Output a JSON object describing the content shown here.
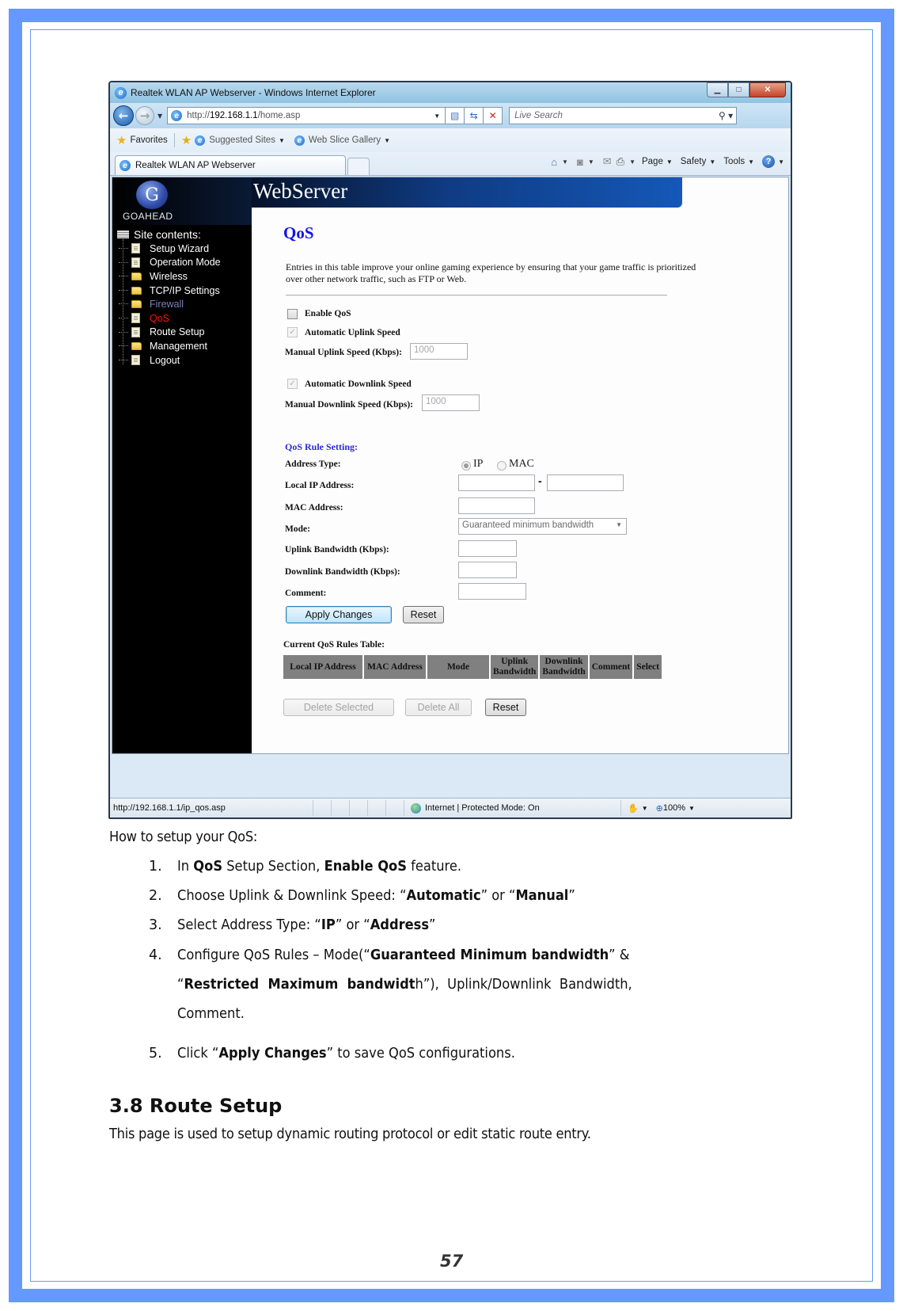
{
  "browser": {
    "window_title": "Realtek WLAN AP Webserver - Windows Internet Explorer",
    "address_prefix": "http://",
    "address_host": "192.168.1.1",
    "address_path": "/home.asp",
    "search_placeholder": "Live Search",
    "favorites_label": "Favorites",
    "fav_items": [
      "Suggested Sites",
      "Web Slice Gallery"
    ],
    "tab_title": "Realtek WLAN AP Webserver",
    "commands": [
      "Page",
      "Safety",
      "Tools"
    ],
    "status_url": "http://192.168.1.1/ip_qos.asp",
    "status_zone": "Internet | Protected Mode: On",
    "zoom_level": "100%"
  },
  "site": {
    "logo_text": "GOAHEAD",
    "banner_title": "WebServer",
    "tree_header": "Site contents:",
    "tree_items": [
      {
        "label": "Setup Wizard",
        "type": "doc",
        "state": "normal"
      },
      {
        "label": "Operation Mode",
        "type": "doc",
        "state": "normal"
      },
      {
        "label": "Wireless",
        "type": "folder",
        "state": "normal"
      },
      {
        "label": "TCP/IP Settings",
        "type": "folder",
        "state": "normal"
      },
      {
        "label": "Firewall",
        "type": "folder",
        "state": "dim"
      },
      {
        "label": "QoS",
        "type": "doc",
        "state": "active"
      },
      {
        "label": "Route Setup",
        "type": "doc",
        "state": "normal"
      },
      {
        "label": "Management",
        "type": "folder",
        "state": "normal"
      },
      {
        "label": "Logout",
        "type": "doc",
        "state": "normal"
      }
    ]
  },
  "qos": {
    "title": "QoS",
    "intro": "Entries in this table improve your online gaming experience by ensuring that your game traffic is prioritized over other network traffic, such as FTP or Web.",
    "enable_qos_label": "Enable QoS",
    "enable_qos_checked": false,
    "auto_uplink_label": "Automatic Uplink Speed",
    "auto_uplink_checked": true,
    "manual_uplink_label": "Manual Uplink Speed (Kbps):",
    "manual_uplink_value": "1000",
    "auto_downlink_label": "Automatic Downlink Speed",
    "auto_downlink_checked": true,
    "manual_downlink_label": "Manual Downlink Speed (Kbps):",
    "manual_downlink_value": "1000",
    "rule_heading": "QoS Rule Setting:",
    "address_type_label": "Address Type:",
    "address_type_options": [
      "IP",
      "MAC"
    ],
    "address_type_selected": "IP",
    "local_ip_label": "Local IP Address:",
    "local_ip_separator": "-",
    "mac_label": "MAC Address:",
    "mode_label": "Mode:",
    "mode_value": "Guaranteed minimum bandwidth",
    "uplink_bw_label": "Uplink Bandwidth (Kbps):",
    "downlink_bw_label": "Downlink Bandwidth (Kbps):",
    "comment_label": "Comment:",
    "apply_button": "Apply Changes",
    "reset_button": "Reset",
    "table_title": "Current QoS Rules Table:",
    "table_headers": [
      [
        "Local IP Address"
      ],
      [
        "MAC Address"
      ],
      [
        "Mode"
      ],
      [
        "Uplink",
        "Bandwidth"
      ],
      [
        "Downlink",
        "Bandwidth"
      ],
      [
        "Comment"
      ],
      [
        "Select"
      ]
    ],
    "delete_selected_button": "Delete Selected",
    "delete_all_button": "Delete All",
    "table_reset_button": "Reset"
  },
  "doc": {
    "how_to": "How to setup your QoS:",
    "steps": [
      [
        {
          "t": "In "
        },
        {
          "t": "QoS",
          "b": true
        },
        {
          "t": " Setup Section, "
        },
        {
          "t": "Enable QoS",
          "b": true
        },
        {
          "t": " feature."
        }
      ],
      [
        {
          "t": "Choose Uplink & Downlink Speed: “"
        },
        {
          "t": "Automatic",
          "b": true
        },
        {
          "t": "” or “"
        },
        {
          "t": "Manual",
          "b": true
        },
        {
          "t": "”"
        }
      ],
      [
        {
          "t": "Select Address Type: “"
        },
        {
          "t": "IP",
          "b": true
        },
        {
          "t": "” or “"
        },
        {
          "t": "Address",
          "b": true
        },
        {
          "t": "”"
        }
      ],
      [
        {
          "t": "Configure QoS Rules – Mode(“"
        },
        {
          "t": "Guaranteed Minimum bandwidth",
          "b": true
        },
        {
          "t": "” &"
        }
      ],
      [
        {
          "t": "Click “"
        },
        {
          "t": "Apply Changes",
          "b": true
        },
        {
          "t": "” to save QoS configurations."
        }
      ]
    ],
    "step4_line2": [
      {
        "t": "“"
      },
      {
        "t": "Restricted  Maximum  bandwidt",
        "b": true
      },
      {
        "t": "h”),  Uplink/Downlink  Bandwidth,"
      }
    ],
    "step4_line3": "Comment.",
    "section_heading": "3.8  Route Setup",
    "section_body": "This page is used to setup dynamic routing protocol or edit static route entry.",
    "page_number": "57"
  },
  "colors": {
    "frame": "#6699ff",
    "qos_title": "#1414e8",
    "active_menu": "#ff1010",
    "table_header_bg": "#808080"
  }
}
